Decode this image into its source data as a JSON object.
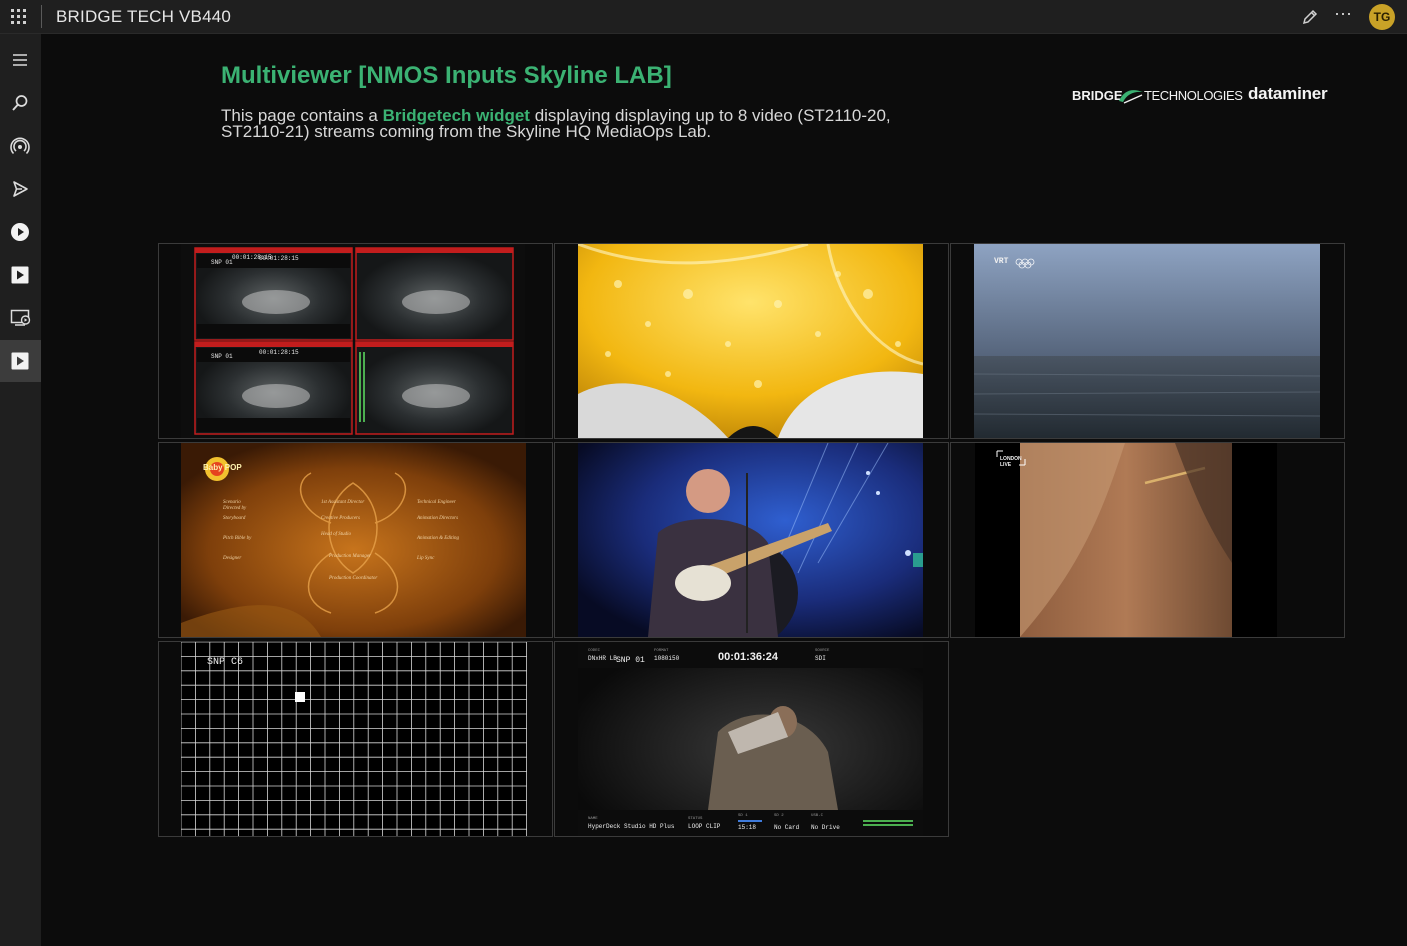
{
  "topbar": {
    "title": "BRIDGE TECH VB440",
    "avatar_initials": "TG"
  },
  "page": {
    "title": "Multiviewer [NMOS Inputs Skyline LAB]",
    "desc_prefix": "This page contains a ",
    "desc_link": "Bridgetech widget",
    "desc_suffix": " displaying displaying up to 8 video (ST2110-20, ST2110-21) streams coming from the Skyline HQ MediaOps Lab."
  },
  "logos": {
    "bridge_bold": "BRIDGE",
    "bridge_rest": "TECHNOLOGIES",
    "dataminer": "dataminer"
  },
  "sidebar": {
    "items": [
      {
        "icon": "hamburger-icon"
      },
      {
        "icon": "search-icon"
      },
      {
        "icon": "broadcast-icon"
      },
      {
        "icon": "send-icon"
      },
      {
        "icon": "play-circle-icon"
      },
      {
        "icon": "play-square-icon"
      },
      {
        "icon": "monitor-play-icon"
      },
      {
        "icon": "play-square-icon",
        "active": true
      }
    ]
  },
  "tiles": [
    {
      "label_quad_timecode": "00:01:28:15",
      "snp_label": "SNP 01"
    },
    {},
    {
      "badge": "VRT"
    },
    {
      "logo_text": "Baby POP"
    },
    {},
    {
      "badge": "LONDON LIVE"
    },
    {
      "snp_label": "SNP C6"
    },
    {
      "snp_label": "SNP 01",
      "timecode": "00:01:36:24",
      "codec_label": "CODEC",
      "codec_value": "DNxHR LB",
      "format_label": "FORMAT",
      "format_value": "1080i50",
      "source_label": "SOURCE",
      "source_value": "SDI",
      "name_label": "NAME",
      "name_value": "HyperDeck Studio HD Plus",
      "status_label": "STATUS",
      "status_value": "LOOP CLIP",
      "sd1_label": "SD 1",
      "sd1_value": "15:18",
      "sd2_label": "SD 2",
      "sd2_value": "No Card",
      "usb_label": "USB-C",
      "usb_value": "No Drive"
    }
  ],
  "colors": {
    "accent": "#3bb273",
    "avatar": "#c9a227"
  }
}
